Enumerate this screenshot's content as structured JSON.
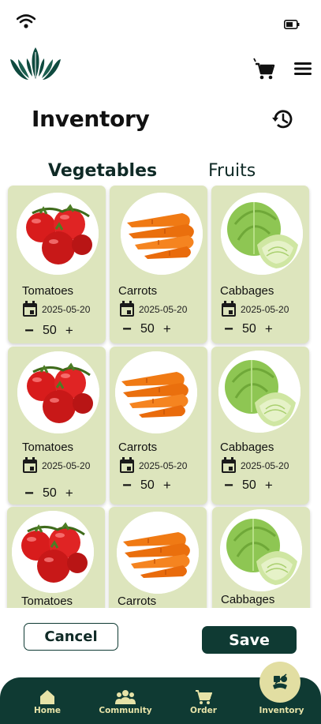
{
  "header": {
    "title": "Inventory"
  },
  "tabs": [
    {
      "label": "Vegetables",
      "active": true
    },
    {
      "label": "Fruits",
      "active": false
    }
  ],
  "items": [
    {
      "name": "Tomatoes",
      "date": "2025-05-20",
      "qty": "50",
      "minus": "−",
      "plus": "+",
      "kind": "tomato"
    },
    {
      "name": "Carrots",
      "date": "2025-05-20",
      "qty": "50",
      "minus": "−",
      "plus": "+",
      "kind": "carrot"
    },
    {
      "name": "Cabbages",
      "date": "2025-05-20",
      "qty": "50",
      "minus": "−",
      "plus": "+",
      "kind": "cabbage"
    },
    {
      "name": "Tomatoes",
      "date": "2025-05-20",
      "qty": "50",
      "minus": "−",
      "plus": "+",
      "kind": "tomato"
    },
    {
      "name": "Carrots",
      "date": "2025-05-20",
      "qty": "50",
      "minus": "−",
      "plus": "+",
      "kind": "carrot"
    },
    {
      "name": "Cabbages",
      "date": "2025-05-20",
      "qty": "50",
      "minus": "−",
      "plus": "+",
      "kind": "cabbage"
    },
    {
      "name": "Tomatoes",
      "kind": "tomato"
    },
    {
      "name": "Carrots",
      "kind": "carrot"
    },
    {
      "name": "Cabbages",
      "kind": "cabbage"
    }
  ],
  "actions": {
    "cancel": "Cancel",
    "save": "Save"
  },
  "nav": [
    {
      "label": "Home",
      "icon": "home-icon"
    },
    {
      "label": "Community",
      "icon": "community-icon"
    },
    {
      "label": "Order",
      "icon": "cart-icon"
    },
    {
      "label": "Inventory",
      "icon": "inventory-icon",
      "active": true
    }
  ],
  "colors": {
    "primary": "#0f3a33",
    "card": "#dde5bd",
    "nav_label": "#e7e3a8",
    "active_bubble": "#e2dea2"
  }
}
